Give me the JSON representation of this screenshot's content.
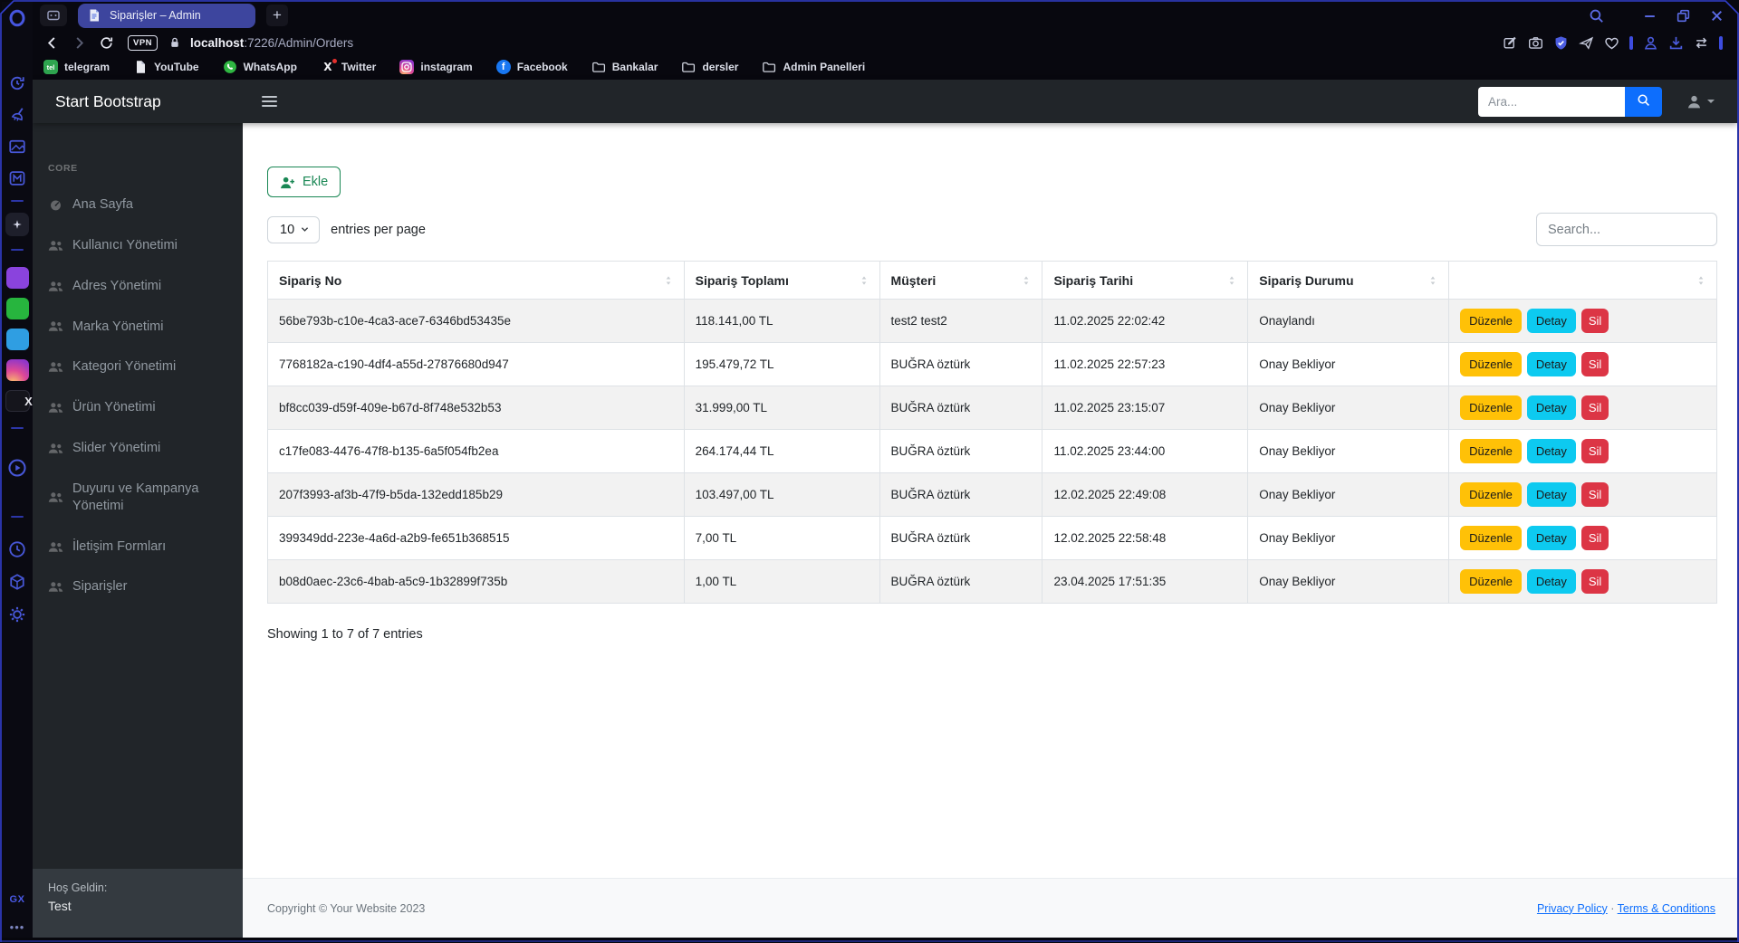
{
  "browser": {
    "tab_title": "Siparişler – Admin",
    "new_tab_label": "+",
    "url_host": "localhost",
    "url_path": ":7226/Admin/Orders",
    "vpn_label": "VPN",
    "rail_footer_label": "GX",
    "rail_more_glyph": "•••",
    "rail": [
      {
        "name": "opera-menu-button",
        "icon": "opera-logo"
      },
      {
        "name": "tab-snoozer-icon",
        "icon": "snoozer"
      },
      {
        "name": "cleaner-icon",
        "icon": "broom"
      },
      {
        "name": "wallpapers-icon",
        "icon": "wallpaper"
      },
      {
        "name": "mods-icon",
        "icon": "mods"
      },
      {
        "name": "rail-divider",
        "divider": true,
        "cls": ""
      },
      {
        "name": "gx-corner-icon",
        "icon": "spark"
      },
      {
        "name": "rail-divider",
        "divider": true,
        "cls": ""
      },
      {
        "name": "twitch-icon",
        "icon": "twitch",
        "brand": true
      },
      {
        "name": "whatsapp-icon",
        "icon": "wa-phone",
        "brand": true
      },
      {
        "name": "telegram-icon",
        "icon": "tg-plane",
        "brand": true
      },
      {
        "name": "instagram-icon",
        "icon": "ig-cam",
        "brand": true
      },
      {
        "name": "x-icon",
        "text": "X",
        "brand": true
      },
      {
        "name": "rail-divider",
        "divider": true,
        "cls": "rd2"
      },
      {
        "name": "player-icon",
        "icon": "player"
      },
      {
        "name": "rail-divider",
        "divider": true,
        "cls": "rd3"
      },
      {
        "name": "history-icon",
        "icon": "clock"
      },
      {
        "name": "gx-games-icon",
        "icon": "cube"
      },
      {
        "name": "settings-icon",
        "icon": "gear"
      }
    ],
    "bookmarks": [
      {
        "label": "telegram",
        "icon": "telegram-favicon"
      },
      {
        "label": "YouTube",
        "icon": "youtube-favicon"
      },
      {
        "label": "WhatsApp",
        "icon": "whatsapp-favicon"
      },
      {
        "label": "Twitter",
        "icon": "twitter-favicon"
      },
      {
        "label": "instagram",
        "icon": "instagram-favicon"
      },
      {
        "label": "Facebook",
        "icon": "facebook-favicon"
      },
      {
        "label": "Bankalar",
        "icon": "folder"
      },
      {
        "label": "dersler",
        "icon": "folder"
      },
      {
        "label": "Admin Panelleri",
        "icon": "folder"
      }
    ]
  },
  "navbar": {
    "brand": "Start Bootstrap",
    "search_placeholder": "Ara..."
  },
  "sidebar": {
    "section": "CORE",
    "items": [
      {
        "label": "Ana Sayfa",
        "icon": "gauge"
      },
      {
        "label": "Kullanıcı Yönetimi",
        "icon": "users"
      },
      {
        "label": "Adres Yönetimi",
        "icon": "users"
      },
      {
        "label": "Marka Yönetimi",
        "icon": "users"
      },
      {
        "label": "Kategori Yönetimi",
        "icon": "users"
      },
      {
        "label": "Ürün Yönetimi",
        "icon": "users"
      },
      {
        "label": "Slider Yönetimi",
        "icon": "users"
      },
      {
        "label": "Duyuru ve Kampanya Yönetimi",
        "icon": "users"
      },
      {
        "label": "İletişim Formları",
        "icon": "users"
      },
      {
        "label": "Siparişler",
        "icon": "users"
      }
    ],
    "footer_label": "Hoş Geldin:",
    "footer_user": "Test"
  },
  "toolbar": {
    "add_label": "Ekle",
    "page_size": "10",
    "entries_label": "entries per page",
    "search_placeholder": "Search..."
  },
  "table": {
    "columns": [
      "Sipariş No",
      "Sipariş Toplamı",
      "Müşteri",
      "Sipariş Tarihi",
      "Sipariş Durumu"
    ],
    "actions": {
      "edit": "Düzenle",
      "detail": "Detay",
      "delete": "Sil"
    },
    "rows": [
      {
        "no": "56be793b-c10e-4ca3-ace7-6346bd53435e",
        "total": "118.141,00 TL",
        "customer": "test2 test2",
        "date": "11.02.2025 22:02:42",
        "status": "Onaylandı"
      },
      {
        "no": "7768182a-c190-4df4-a55d-27876680d947",
        "total": "195.479,72 TL",
        "customer": "BUĞRA öztürk",
        "date": "11.02.2025 22:57:23",
        "status": "Onay Bekliyor"
      },
      {
        "no": "bf8cc039-d59f-409e-b67d-8f748e532b53",
        "total": "31.999,00 TL",
        "customer": "BUĞRA öztürk",
        "date": "11.02.2025 23:15:07",
        "status": "Onay Bekliyor"
      },
      {
        "no": "c17fe083-4476-47f8-b135-6a5f054fb2ea",
        "total": "264.174,44 TL",
        "customer": "BUĞRA öztürk",
        "date": "11.02.2025 23:44:00",
        "status": "Onay Bekliyor"
      },
      {
        "no": "207f3993-af3b-47f9-b5da-132edd185b29",
        "total": "103.497,00 TL",
        "customer": "BUĞRA öztürk",
        "date": "12.02.2025 22:49:08",
        "status": "Onay Bekliyor"
      },
      {
        "no": "399349dd-223e-4a6d-a2b9-fe651b368515",
        "total": "7,00 TL",
        "customer": "BUĞRA öztürk",
        "date": "12.02.2025 22:58:48",
        "status": "Onay Bekliyor"
      },
      {
        "no": "b08d0aec-23c6-4bab-a5c9-1b32899f735b",
        "total": "1,00 TL",
        "customer": "BUĞRA öztürk",
        "date": "23.04.2025 17:51:35",
        "status": "Onay Bekliyor"
      }
    ],
    "summary": "Showing 1 to 7 of 7 entries"
  },
  "footer": {
    "copyright": "Copyright © Your Website 2023",
    "privacy": "Privacy Policy",
    "separator": " · ",
    "terms": "Terms & Conditions"
  },
  "colors": {
    "accent_blue": "#0d6efd",
    "browser_accent": "#4050e0",
    "warning": "#ffc107",
    "info": "#0dcaf0",
    "danger": "#dc3545",
    "success": "#198754",
    "tab_active": "#3d459e",
    "chrome_bg": "#0a0a12",
    "panel_dark": "#212529",
    "stripe": "#f2f2f2"
  }
}
